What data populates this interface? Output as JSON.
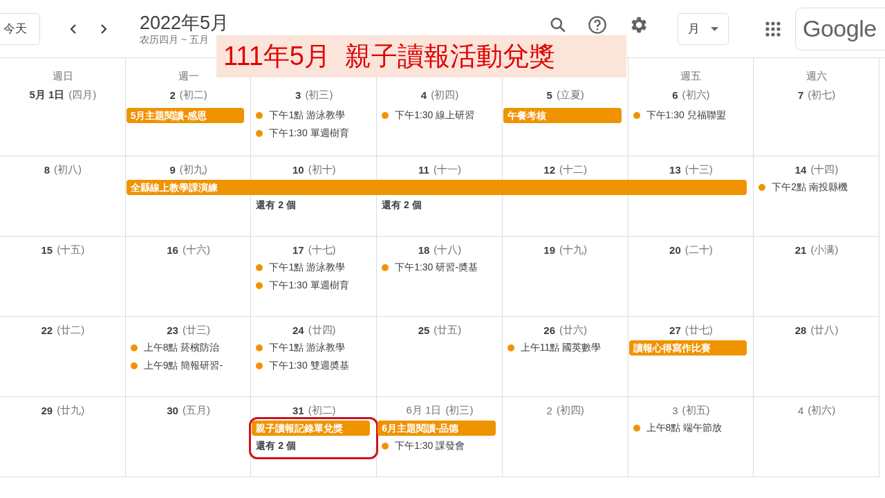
{
  "header": {
    "today_button": "今天",
    "title": "2022年5月",
    "subtitle": "农历四月 ~ 五月",
    "view_selector": "月",
    "logo": "Google"
  },
  "banner": "111年5月  親子讀報活動兌獎",
  "weeks": [
    {
      "days": [
        {
          "weekday": "週日",
          "date": "5月 1日",
          "lunar": "(四月)",
          "other_month": false
        },
        {
          "weekday": "週一",
          "date": "2",
          "lunar": "(初二)",
          "other_month": false,
          "events": [
            {
              "kind": "bar",
              "text": "5月主題閱讀-感恩"
            }
          ]
        },
        {
          "date": "3",
          "lunar": "(初三)",
          "other_month": false,
          "events": [
            {
              "kind": "dot",
              "text": "下午1點 游泳教學"
            },
            {
              "kind": "dot",
              "text": "下午1:30 單週樹育"
            }
          ]
        },
        {
          "date": "4",
          "lunar": "(初四)",
          "other_month": false,
          "events": [
            {
              "kind": "dot",
              "text": "下午1:30 線上研習"
            }
          ]
        },
        {
          "date": "5",
          "lunar": "(立夏)",
          "other_month": false,
          "events": [
            {
              "kind": "bar",
              "text": "午餐考核"
            }
          ]
        },
        {
          "weekday": "週五",
          "date": "6",
          "lunar": "(初六)",
          "other_month": false,
          "events": [
            {
              "kind": "dot",
              "text": "下午1:30 兒福聯盟"
            }
          ]
        },
        {
          "weekday": "週六",
          "date": "7",
          "lunar": "(初七)",
          "other_month": false
        }
      ]
    },
    {
      "days": [
        {
          "date": "8",
          "lunar": "(初八)",
          "other_month": false
        },
        {
          "date": "9",
          "lunar": "(初九)",
          "other_month": false,
          "events": [
            {
              "kind": "bar",
              "text": "全縣線上教學課演練"
            }
          ]
        },
        {
          "date": "10",
          "lunar": "(初十)",
          "other_month": false,
          "events": [
            {
              "kind": "continued"
            },
            {
              "kind": "more",
              "text": "還有 2 個"
            }
          ]
        },
        {
          "date": "11",
          "lunar": "(十一)",
          "other_month": false,
          "events": [
            {
              "kind": "continued"
            },
            {
              "kind": "more",
              "text": "還有 2 個"
            }
          ]
        },
        {
          "date": "12",
          "lunar": "(十二)",
          "other_month": false,
          "events": [
            {
              "kind": "continued"
            }
          ]
        },
        {
          "date": "13",
          "lunar": "(十三)",
          "other_month": false,
          "events": [
            {
              "kind": "continued"
            }
          ]
        },
        {
          "date": "14",
          "lunar": "(十四)",
          "other_month": false,
          "events": [
            {
              "kind": "dot",
              "text": "下午2點 南投縣機"
            }
          ]
        }
      ]
    },
    {
      "days": [
        {
          "date": "15",
          "lunar": "(十五)",
          "other_month": false
        },
        {
          "date": "16",
          "lunar": "(十六)",
          "other_month": false
        },
        {
          "date": "17",
          "lunar": "(十七)",
          "other_month": false,
          "events": [
            {
              "kind": "dot",
              "text": "下午1點 游泳教學"
            },
            {
              "kind": "dot",
              "text": "下午1:30 單週樹育"
            }
          ]
        },
        {
          "date": "18",
          "lunar": "(十八)",
          "other_month": false,
          "events": [
            {
              "kind": "dot",
              "text": "下午1:30 研習-奬基"
            }
          ]
        },
        {
          "date": "19",
          "lunar": "(十九)",
          "other_month": false
        },
        {
          "date": "20",
          "lunar": "(二十)",
          "other_month": false
        },
        {
          "date": "21",
          "lunar": "(小满)",
          "other_month": false
        }
      ]
    },
    {
      "days": [
        {
          "date": "22",
          "lunar": "(廿二)",
          "other_month": false
        },
        {
          "date": "23",
          "lunar": "(廿三)",
          "other_month": false,
          "events": [
            {
              "kind": "dot",
              "text": "上午8點 菸檳防治"
            },
            {
              "kind": "dot",
              "text": "上午9點 簡報研習-"
            }
          ]
        },
        {
          "date": "24",
          "lunar": "(廿四)",
          "other_month": false,
          "events": [
            {
              "kind": "dot",
              "text": "下午1點 游泳教學"
            },
            {
              "kind": "dot",
              "text": "下午1:30 雙週奬基"
            }
          ]
        },
        {
          "date": "25",
          "lunar": "(廿五)",
          "other_month": false
        },
        {
          "date": "26",
          "lunar": "(廿六)",
          "other_month": false,
          "events": [
            {
              "kind": "dot",
              "text": "上午11點 國英數學"
            }
          ]
        },
        {
          "date": "27",
          "lunar": "(廿七)",
          "other_month": false,
          "events": [
            {
              "kind": "bar",
              "text": "讀報心得寫作比賽"
            }
          ]
        },
        {
          "date": "28",
          "lunar": "(廿八)",
          "other_month": false
        }
      ]
    },
    {
      "days": [
        {
          "date": "29",
          "lunar": "(廿九)",
          "other_month": false
        },
        {
          "date": "30",
          "lunar": "(五月)",
          "other_month": false
        },
        {
          "date": "31",
          "lunar": "(初二)",
          "other_month": false,
          "highlighted": true,
          "events": [
            {
              "kind": "bar",
              "text": "親子讀報記錄單兌獎"
            },
            {
              "kind": "more",
              "text": "還有 2 個"
            }
          ]
        },
        {
          "date": "6月 1日",
          "lunar": "(初三)",
          "other_month": true,
          "events": [
            {
              "kind": "bar",
              "text": "6月主題閱讀-品德"
            },
            {
              "kind": "dot",
              "text": "下午1:30 課發會"
            }
          ]
        },
        {
          "date": "2",
          "lunar": "(初四)",
          "other_month": true
        },
        {
          "date": "3",
          "lunar": "(初五)",
          "other_month": true,
          "events": [
            {
              "kind": "dot",
              "text": "上午8點 端午節放"
            }
          ]
        },
        {
          "date": "4",
          "lunar": "(初六)",
          "other_month": true
        }
      ]
    }
  ]
}
